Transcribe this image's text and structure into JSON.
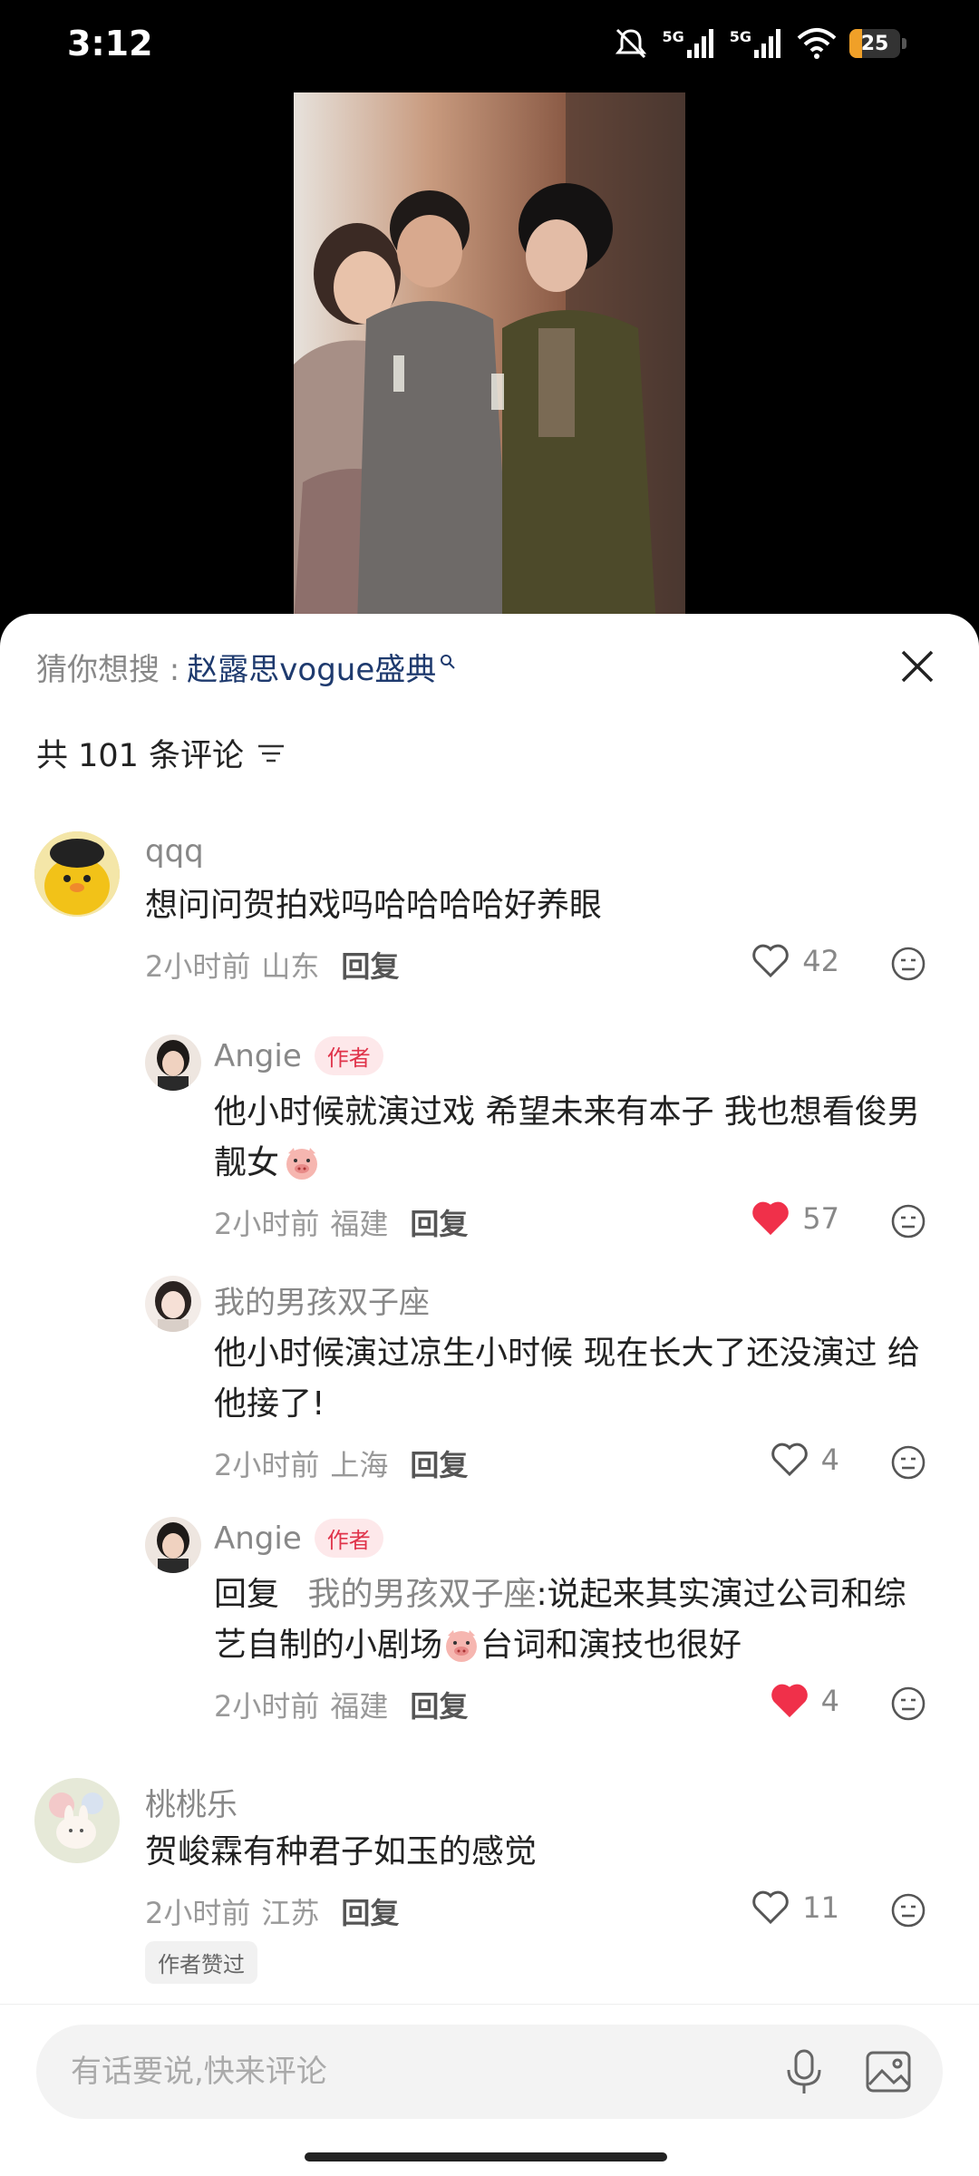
{
  "status_bar": {
    "time": "3:12",
    "network_1": "5G",
    "network_2": "5G",
    "battery_level": "25",
    "battery_color": "#f0a028"
  },
  "sheet": {
    "suggest_prefix": "猜你想搜 :",
    "suggest_term": "赵露思vogue盛典",
    "comment_count_label": "共 101 条评论"
  },
  "comments": [
    {
      "username": "qqq",
      "text": "想问问贺拍戏吗哈哈哈哈好养眼",
      "time": "2小时前",
      "location": "山东",
      "reply_label": "回复",
      "likes": "42",
      "liked": false
    },
    {
      "username": "Angie",
      "badge": "作者",
      "text_line1": "他小时候就演过戏 希望未来有本子 我也想看俊男",
      "text_line2": "靓女",
      "time": "2小时前",
      "location": "福建",
      "reply_label": "回复",
      "likes": "57",
      "liked": true
    },
    {
      "username": "我的男孩双子座",
      "text_line1": "他小时候演过凉生小时候 现在长大了还没演过 给",
      "text_line2": "他接了!",
      "time": "2小时前",
      "location": "上海",
      "reply_label": "回复",
      "likes": "4",
      "liked": false
    },
    {
      "username": "Angie",
      "badge": "作者",
      "reply_prefix": "回复",
      "reply_target": "我的男孩双子座",
      "text_line1": ":说起来其实演过公司和综",
      "text_line2a": "艺自制的小剧场",
      "text_line2b": "台词和演技也很好",
      "time": "2小时前",
      "location": "福建",
      "reply_label": "回复",
      "likes": "4",
      "liked": true
    },
    {
      "username": "桃桃乐",
      "text": "贺峻霖有种君子如玉的感觉",
      "time": "2小时前",
      "location": "江苏",
      "reply_label": "回复",
      "likes": "11",
      "liked": false,
      "chip": "作者赞过"
    }
  ],
  "input": {
    "placeholder": "有话要说,快来评论"
  },
  "colors": {
    "like_active": "#f0304a",
    "author_badge": "#e0334a",
    "suggest_term": "#1e3a6e"
  }
}
